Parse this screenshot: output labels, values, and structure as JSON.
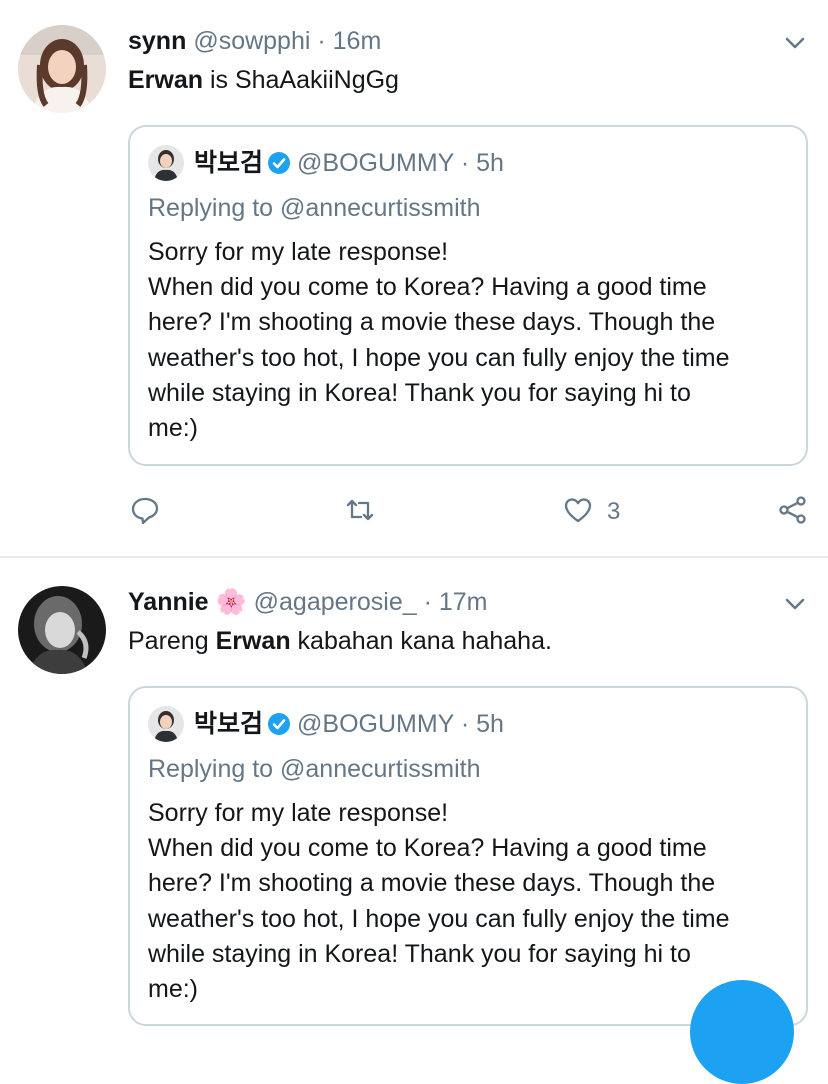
{
  "colors": {
    "accent": "#1da1f2",
    "text_primary": "#14171a",
    "text_secondary": "#657786",
    "border": "#ccd6dd"
  },
  "tweets": [
    {
      "display_name": "synn",
      "handle": "@sowpphi",
      "time": "· 16m",
      "text_mention": "Erwan",
      "text_rest": " is ShaAakiiNgGg",
      "quote": {
        "name": "박보검",
        "handle": "@BOGUMMY",
        "time": "· 5h",
        "replying": "Replying to @annecurtissmith",
        "lines": [
          "Sorry for my late response!",
          "When did you come to Korea? Having a good time",
          "here? I'm shooting a movie these days. Though the",
          "weather's too hot, I hope you can fully enjoy the time",
          "while staying in Korea! Thank you for saying hi to",
          "me:)"
        ]
      },
      "like_count": "3"
    },
    {
      "display_name": "Yannie",
      "emoji": "🌸",
      "handle": "@agaperosie_",
      "time": "· 17m",
      "text_before": "Pareng ",
      "text_mention": "Erwan",
      "text_rest": " kabahan kana hahaha.",
      "quote": {
        "name": "박보검",
        "handle": "@BOGUMMY",
        "time": "· 5h",
        "replying": "Replying to @annecurtissmith",
        "lines": [
          "Sorry for my late response!",
          "When did you come to Korea? Having a good time",
          "here? I'm shooting a movie these days. Though the",
          "weather's too hot, I hope you can fully enjoy the time",
          "while staying in Korea! Thank you for saying hi to",
          "me:)"
        ]
      }
    }
  ],
  "icons": {
    "caret": "chevron-down-icon",
    "reply": "reply-icon",
    "retweet": "retweet-icon",
    "like": "heart-icon",
    "share": "share-icon",
    "verified": "verified-badge-icon",
    "fab": "compose-tweet-icon"
  }
}
